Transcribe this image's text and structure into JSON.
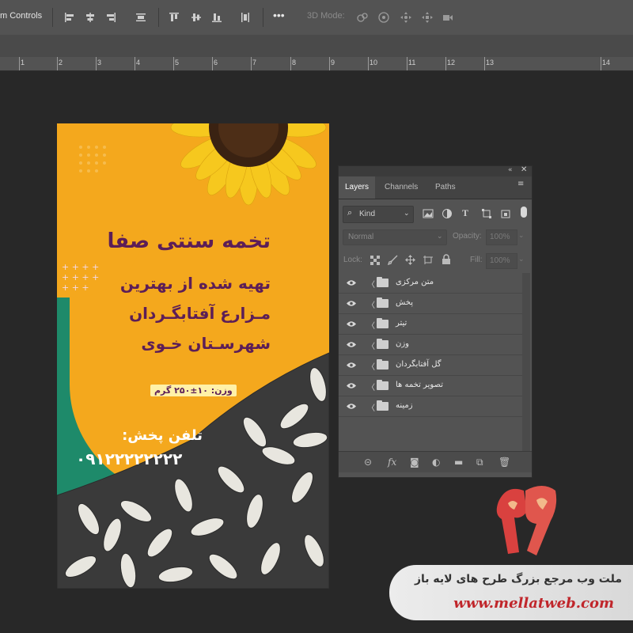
{
  "options_bar": {
    "transform_controls": "m Controls",
    "mode_3d": "3D Mode:"
  },
  "ruler": {
    "numbers": [
      "1",
      "2",
      "3",
      "4",
      "5",
      "6",
      "7",
      "8",
      "9",
      "10",
      "11",
      "12",
      "13",
      "14"
    ]
  },
  "poster": {
    "title": "تخمه سنتی صفا",
    "line1": "تهیه شده از بهترین",
    "line2": "مـزارع آفتابگـردان",
    "line3": "شهرسـتان خـوی",
    "weight": "وزن: ۱۰±۲۵۰ گرم",
    "phone_label": "تلفن پخش:",
    "phone_number": "۰۹۱۲۲۲۲۲۲۲۲",
    "colors": {
      "green": "#1e8a6a",
      "yellow": "#f4a81d",
      "purple": "#5c1e57"
    }
  },
  "layers_panel": {
    "tabs": [
      "Layers",
      "Channels",
      "Paths"
    ],
    "active_tab": "Layers",
    "filter_kind": "Kind",
    "blend_mode": "Normal",
    "opacity_label": "Opacity:",
    "opacity_value": "100%",
    "lock_label": "Lock:",
    "fill_label": "Fill:",
    "fill_value": "100%",
    "layers": [
      {
        "name": "متن مرکزی"
      },
      {
        "name": "پخش"
      },
      {
        "name": "تیتر"
      },
      {
        "name": "وزن"
      },
      {
        "name": "گل آفتابگردان"
      },
      {
        "name": "تصویر تخمه ها"
      },
      {
        "name": "زمینه"
      }
    ]
  },
  "watermark": {
    "tagline": "ملت وب مرجع بزرگ طرح های لایه باز",
    "url": "www.mellatweb.com",
    "logo_color": "#d9413f"
  }
}
